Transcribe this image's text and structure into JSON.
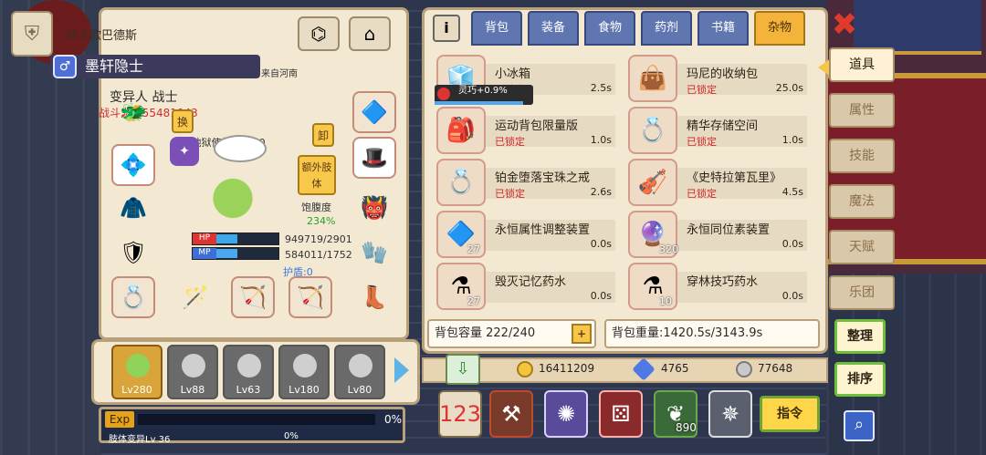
{
  "char": {
    "guild": "地之欧巴德斯",
    "name": "墨轩隐士",
    "origin": "来自河南",
    "class": "变异人 战士",
    "power": "战斗力:455481043",
    "sub": "S阶 地狱使徒Lv 100",
    "swap": "换",
    "unload": "卸",
    "extra": "额外肢体",
    "satiety_label": "饱腹度",
    "satiety": "234%",
    "hp_label": "HP",
    "mp_label": "MP",
    "hp": "949719/2901",
    "mp": "584011/1752",
    "shield": "护盾:0",
    "hp_fraction": 0.33,
    "mp_fraction": 0.33
  },
  "party": [
    {
      "level": "Lv280",
      "active": true
    },
    {
      "level": "Lv88"
    },
    {
      "level": "Lv63"
    },
    {
      "level": "Lv180"
    },
    {
      "level": "Lv80"
    }
  ],
  "exp": {
    "label": "Exp",
    "pct": "0%",
    "level_text": "肢体变异Lv 36",
    "pct2": "0%",
    "fraction": 0
  },
  "tabs": [
    "背包",
    "装备",
    "食物",
    "药剂",
    "书籍",
    "杂物"
  ],
  "selected_tab": "杂物",
  "buff": {
    "text": "灵巧+0.9%",
    "fraction": 0.9
  },
  "items": [
    {
      "name": "小冰箱",
      "status": "已锁定",
      "time": "2.5s",
      "count": "",
      "icon": "fridge-icon"
    },
    {
      "name": "玛尼的收纳包",
      "status": "已锁定",
      "time": "25.0s",
      "count": "",
      "icon": "storage-bag-icon"
    },
    {
      "name": "运动背包限量版",
      "status": "已锁定",
      "time": "1.0s",
      "count": "",
      "icon": "backpack-icon"
    },
    {
      "name": "精华存储空间",
      "status": "已锁定",
      "time": "1.0s",
      "count": "",
      "icon": "ring-icon"
    },
    {
      "name": "铂金堕落宝珠之戒",
      "status": "已锁定",
      "time": "2.6s",
      "count": "",
      "icon": "ring-icon"
    },
    {
      "name": "《史特拉第瓦里》",
      "status": "已锁定",
      "time": "4.5s",
      "count": "",
      "icon": "violin-icon"
    },
    {
      "name": "永恒属性调整装置",
      "status": "",
      "time": "0.0s",
      "count": "27",
      "icon": "device-icon"
    },
    {
      "name": "永恒同位素装置",
      "status": "",
      "time": "0.0s",
      "count": "320",
      "icon": "crystal-icon"
    },
    {
      "name": "毁灭记忆药水",
      "status": "",
      "time": "0.0s",
      "count": "27",
      "icon": "potion-icon"
    },
    {
      "name": "穿林技巧药水",
      "status": "",
      "time": "0.0s",
      "count": "10",
      "icon": "potion-icon"
    }
  ],
  "capacity": "背包容量 222/240",
  "plus": "+",
  "weight": "背包重量:1420.5s/3143.9s",
  "resources": {
    "gold": "16411209",
    "diamond": "4765",
    "silver": "77648"
  },
  "tool_count": "890",
  "command": "指令",
  "side": [
    "道具",
    "属性",
    "技能",
    "魔法",
    "天赋",
    "乐团"
  ],
  "sort_buttons": [
    "整理",
    "排序"
  ],
  "colors": {
    "accent": "#f4b43a",
    "locked": "#d52727",
    "tab": "#5f76b0",
    "green": "#6fbf3a"
  }
}
